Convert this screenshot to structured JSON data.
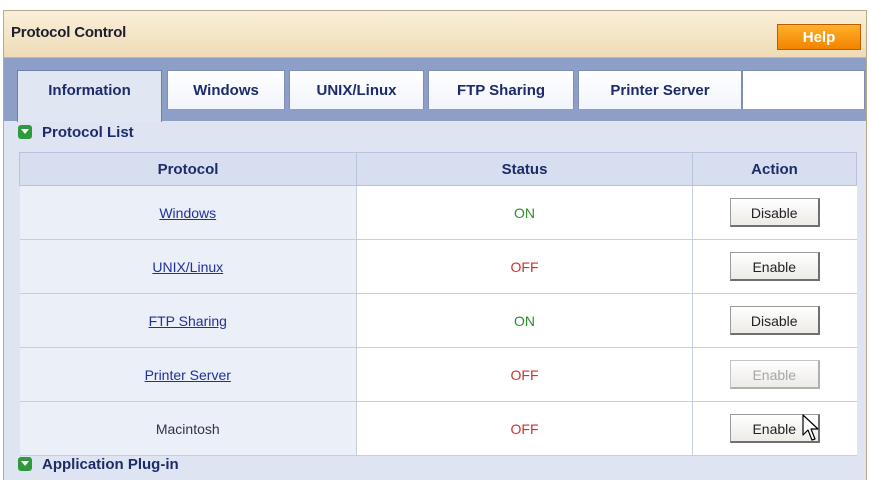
{
  "title": "Protocol Control",
  "help_label": "Help",
  "tabs": [
    {
      "label": "Information",
      "active": true
    },
    {
      "label": "Windows",
      "active": false
    },
    {
      "label": "UNIX/Linux",
      "active": false
    },
    {
      "label": "FTP Sharing",
      "active": false
    },
    {
      "label": "Printer Server",
      "active": false
    }
  ],
  "sections": {
    "protocol_list": "Protocol List",
    "application_plugin": "Application Plug-in"
  },
  "table": {
    "headers": {
      "protocol": "Protocol",
      "status": "Status",
      "action": "Action"
    },
    "rows": [
      {
        "protocol": "Windows",
        "link": true,
        "status": "ON",
        "action": "Disable",
        "enabled": true
      },
      {
        "protocol": "UNIX/Linux",
        "link": true,
        "status": "OFF",
        "action": "Enable",
        "enabled": true
      },
      {
        "protocol": "FTP Sharing",
        "link": true,
        "status": "ON",
        "action": "Disable",
        "enabled": true
      },
      {
        "protocol": "Printer Server",
        "link": true,
        "status": "OFF",
        "action": "Enable",
        "enabled": false
      },
      {
        "protocol": "Macintosh",
        "link": false,
        "status": "OFF",
        "action": "Enable",
        "enabled": true
      }
    ]
  },
  "colors": {
    "status_on": "#2d8d2d",
    "status_off": "#d03030",
    "help_button": "#f28400",
    "tab_strip": "#8d9fc7"
  },
  "icons": {
    "section_icon": "expand-section-icon",
    "cursor": "mouse-pointer-icon"
  }
}
